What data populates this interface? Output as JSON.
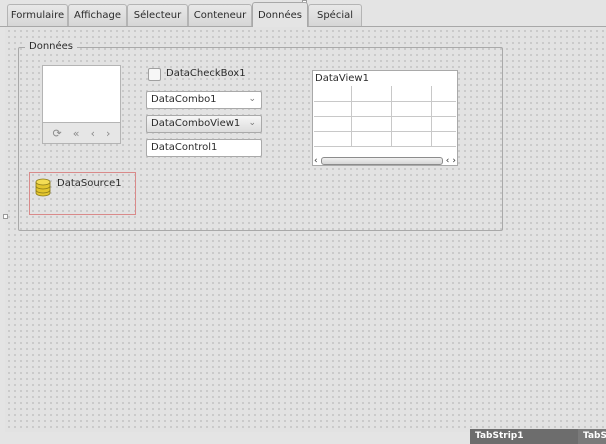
{
  "tabs": [
    {
      "label": "Formulaire"
    },
    {
      "label": "Affichage"
    },
    {
      "label": "Sélecteur"
    },
    {
      "label": "Conteneur"
    },
    {
      "label": "Données"
    },
    {
      "label": "Spécial"
    }
  ],
  "active_tab": "Données",
  "frame": {
    "title": "Données"
  },
  "widgets": {
    "checkbox": {
      "label": "DataCheckBox1"
    },
    "combo": {
      "value": "DataCombo1"
    },
    "comboview": {
      "value": "DataComboView1"
    },
    "control": {
      "value": "DataControl1"
    },
    "dataview": {
      "title": "DataView1"
    },
    "datasource": {
      "label": "DataSource1"
    }
  },
  "navigator_icons": [
    "refresh-icon",
    "first-icon",
    "previous-icon",
    "next-icon"
  ],
  "status": {
    "tab1": "TabStrip1",
    "tab2": "TabSt"
  },
  "colors": {
    "selection": "#d98a8a",
    "active_status": "#6d6d6d"
  }
}
